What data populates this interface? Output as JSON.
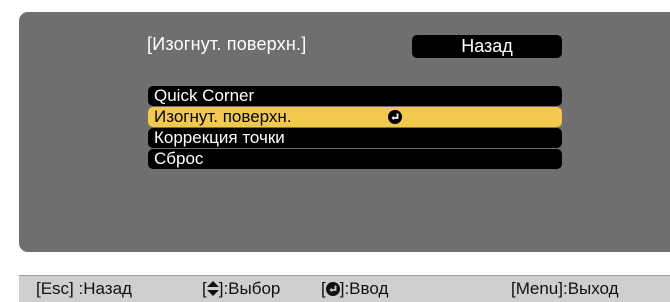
{
  "menu": {
    "title": "[Изогнут. поверхн.]",
    "back_label": "Назад",
    "items": [
      {
        "label": "Quick Corner"
      },
      {
        "label": "Изогнут. поверхн."
      },
      {
        "label": "Коррекция точки"
      },
      {
        "label": "Сброс"
      }
    ],
    "selected_index": 1
  },
  "status_bar": {
    "esc": "[Esc] :Назад",
    "select_pre": "[",
    "select_post": "]:Выбор",
    "enter_pre": "[",
    "enter_post": "]:Ввод",
    "menu": "[Menu]:Выход"
  },
  "colors": {
    "panel": "#6f6f6f",
    "item_bg": "#000000",
    "selected_bg": "#f2c94c",
    "status_bg": "#cfcfcf"
  },
  "icons": {
    "enter": "enter-icon",
    "updown": "up-down-arrow-icon"
  }
}
